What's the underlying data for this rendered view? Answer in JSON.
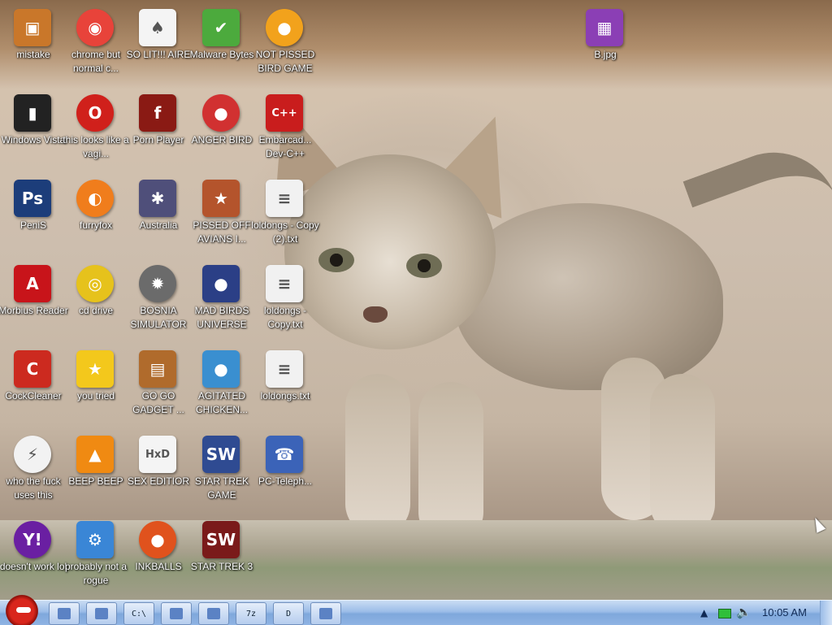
{
  "desktop": {
    "icons": [
      {
        "label": "mistake",
        "icon": "computer-icon",
        "color": "#c9772a"
      },
      {
        "label": "chrome but normal c...",
        "icon": "chrome-icon",
        "color": "#e8433a"
      },
      {
        "label": "SO LIT!!! AIRE",
        "icon": "cards-icon",
        "color": "#f4f4f4"
      },
      {
        "label": "Malware Bytes",
        "icon": "shield-icon",
        "color": "#4caa3d"
      },
      {
        "label": "NOT PISSED BIRD GAME",
        "icon": "pig-icon",
        "color": "#f2a21c"
      },
      {
        "label": "Windows Vista",
        "icon": "trash-bin-icon",
        "color": "#222222"
      },
      {
        "label": "this looks like a vagi...",
        "icon": "opera-icon",
        "color": "#d0201b"
      },
      {
        "label": "Porn Player",
        "icon": "flash-icon",
        "color": "#8a1a14"
      },
      {
        "label": "ANGER BIRD",
        "icon": "angry-bird-icon",
        "color": "#d13131"
      },
      {
        "label": "Embarcad... Dev-C++",
        "icon": "devcpp-icon",
        "color": "#c91d1d"
      },
      {
        "label": "PeniS",
        "icon": "photoshop-icon",
        "color": "#1c3d7a"
      },
      {
        "label": "furryfox",
        "icon": "firefox-icon",
        "color": "#f07d1c"
      },
      {
        "label": "Australia",
        "icon": "spider-icon",
        "color": "#4f4f7a"
      },
      {
        "label": "PISSED OFF AVIANS I...",
        "icon": "seasons-icon",
        "color": "#b4542c"
      },
      {
        "label": "loldongs - Copy (2).txt",
        "icon": "text-file-icon",
        "color": "#f1f1f1"
      },
      {
        "label": "Morbius Reader",
        "icon": "acrobat-icon",
        "color": "#c8141a"
      },
      {
        "label": "cd drive",
        "icon": "cd-icon",
        "color": "#e6c21c"
      },
      {
        "label": "BOSNIA SIMULATOR",
        "icon": "mine-icon",
        "color": "#6b6b6b"
      },
      {
        "label": "MAD BIRDS UNIVERSE",
        "icon": "space-bird-icon",
        "color": "#2b3f86"
      },
      {
        "label": "loldongs - Copy.txt",
        "icon": "text-file-icon",
        "color": "#f1f1f1"
      },
      {
        "label": "CockCleaner",
        "icon": "ccleaner-icon",
        "color": "#cc2a1f"
      },
      {
        "label": "you tried",
        "icon": "star-icon",
        "color": "#f3c81c"
      },
      {
        "label": "GO GO GADGET ...",
        "icon": "briefcase-icon",
        "color": "#b06b2c"
      },
      {
        "label": "AGITATED CHICKEN...",
        "icon": "rio-bird-icon",
        "color": "#3a8fd0"
      },
      {
        "label": "loldongs.txt",
        "icon": "text-file-icon",
        "color": "#f1f1f1"
      },
      {
        "label": "who the fuck uses this",
        "icon": "winamp-icon",
        "color": "#f2f2f2"
      },
      {
        "label": "BEEP BEEP",
        "icon": "vlc-icon",
        "color": "#f08a12"
      },
      {
        "label": "SEX EDITIOR",
        "icon": "hxd-icon",
        "color": "#f4f4f4"
      },
      {
        "label": "STAR TREK GAME",
        "icon": "star-wars-icon",
        "color": "#2f4b92"
      },
      {
        "label": "PC-Teleph...",
        "icon": "telephone-pc-icon",
        "color": "#3b63b8"
      },
      {
        "label": "doesn't work lol",
        "icon": "yahoo-icon",
        "color": "#6a1fa2"
      },
      {
        "label": "probably not a rogue",
        "icon": "settings-icon",
        "color": "#3a86d6"
      },
      {
        "label": "INKBALLS",
        "icon": "inkball-icon",
        "color": "#e0521d"
      },
      {
        "label": "STAR TREK 3",
        "icon": "star-wars-icon",
        "color": "#7a1a1a"
      },
      {
        "label": "B.jpg",
        "icon": "image-file-icon",
        "color": "#8b3fb5"
      }
    ],
    "wallpaper": "kitten"
  },
  "taskbar": {
    "start_icon": "angry-bird-start-icon",
    "items": [
      {
        "icon": "explorer-icon",
        "label": ""
      },
      {
        "icon": "chrome-icon",
        "label": ""
      },
      {
        "icon": "cmd-icon",
        "label": "C:\\"
      },
      {
        "icon": "window-icon",
        "label": ""
      },
      {
        "icon": "network-icon",
        "label": ""
      },
      {
        "icon": "7zip-icon",
        "label": "7z"
      },
      {
        "icon": "dependency-icon",
        "label": "D"
      },
      {
        "icon": "app-icon",
        "label": ""
      }
    ],
    "tray": {
      "arrow": "▲",
      "network_icon": "network-tray-icon",
      "volume_icon": "volume-icon"
    },
    "clock": "10:05 AM",
    "accent": "#8fb3e3"
  }
}
